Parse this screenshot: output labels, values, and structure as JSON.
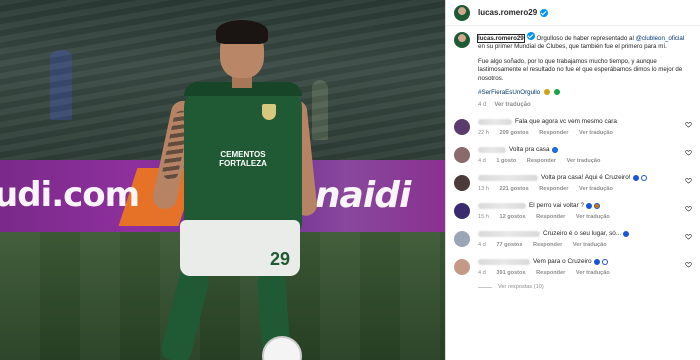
{
  "post": {
    "username": "lucas.romero29",
    "caption_mention_start": "lucas.romero29",
    "caption_lines_1": "Orgulloso de haber representado al",
    "caption_mention_club": "@clubleon_oficial",
    "caption_lines_1b": "en su primer Mundial de Clubes, que también fue el primero para mí.",
    "caption_para_2": "Fue algo soñado, por lo que trabajamos mucho tiempo, y aunque lastimosamente el resultado no fue el que esperábamos dimos lo mejor de nosotros.",
    "hashtag": "#SerFieraEsUnOrgullo",
    "time": "4 d",
    "see_translation": "Ver tradução"
  },
  "comments": [
    {
      "text": "Fala que agora vc vem mesmo cara",
      "time": "22 h",
      "likes": "209 gostos",
      "reply": "Responder",
      "translate": "Ver tradução",
      "avatar_color": "#5b3a6e",
      "emoji": []
    },
    {
      "text": "Volta pra casa",
      "time": "4 d",
      "likes": "1 gosto",
      "reply": "Responder",
      "translate": "Ver tradução",
      "avatar_color": "#8a6a6a",
      "emoji": [
        "#1a73e8"
      ]
    },
    {
      "text": "Volta pra casa! Aqui é Cruzeiro!",
      "time": "13 h",
      "likes": "221 gostos",
      "reply": "Responder",
      "translate": "Ver tradução",
      "avatar_color": "#4a3a3a",
      "emoji": [
        "#1a56db",
        "#ffffff"
      ]
    },
    {
      "text": "El perro vai voltar ?",
      "time": "15 h",
      "likes": "12 gostos",
      "reply": "Responder",
      "translate": "Ver tradução",
      "avatar_color": "#3a2a6e",
      "emoji": [
        "#1a56db",
        "#d97706"
      ]
    },
    {
      "text": "Cruzeiro é o seu lugar, só...",
      "time": "4 d",
      "likes": "77 gostos",
      "reply": "Responder",
      "translate": "Ver tradução",
      "avatar_color": "#9aa6b6",
      "emoji": [
        "#1a56db"
      ]
    },
    {
      "text": "Vem para o Cruzeiro",
      "time": "4 d",
      "likes": "391 gostos",
      "reply": "Responder",
      "translate": "Ver tradução",
      "avatar_color": "#c49a86",
      "emoji": [
        "#1a56db",
        "#ffffff"
      ]
    }
  ],
  "view_replies": "Ver respostas (10)",
  "photo": {
    "ad_left": "udi.com",
    "ad_right": "Snaidi",
    "shirt_number": "29",
    "sponsor": "CEMENTOS FORTALEZA"
  }
}
